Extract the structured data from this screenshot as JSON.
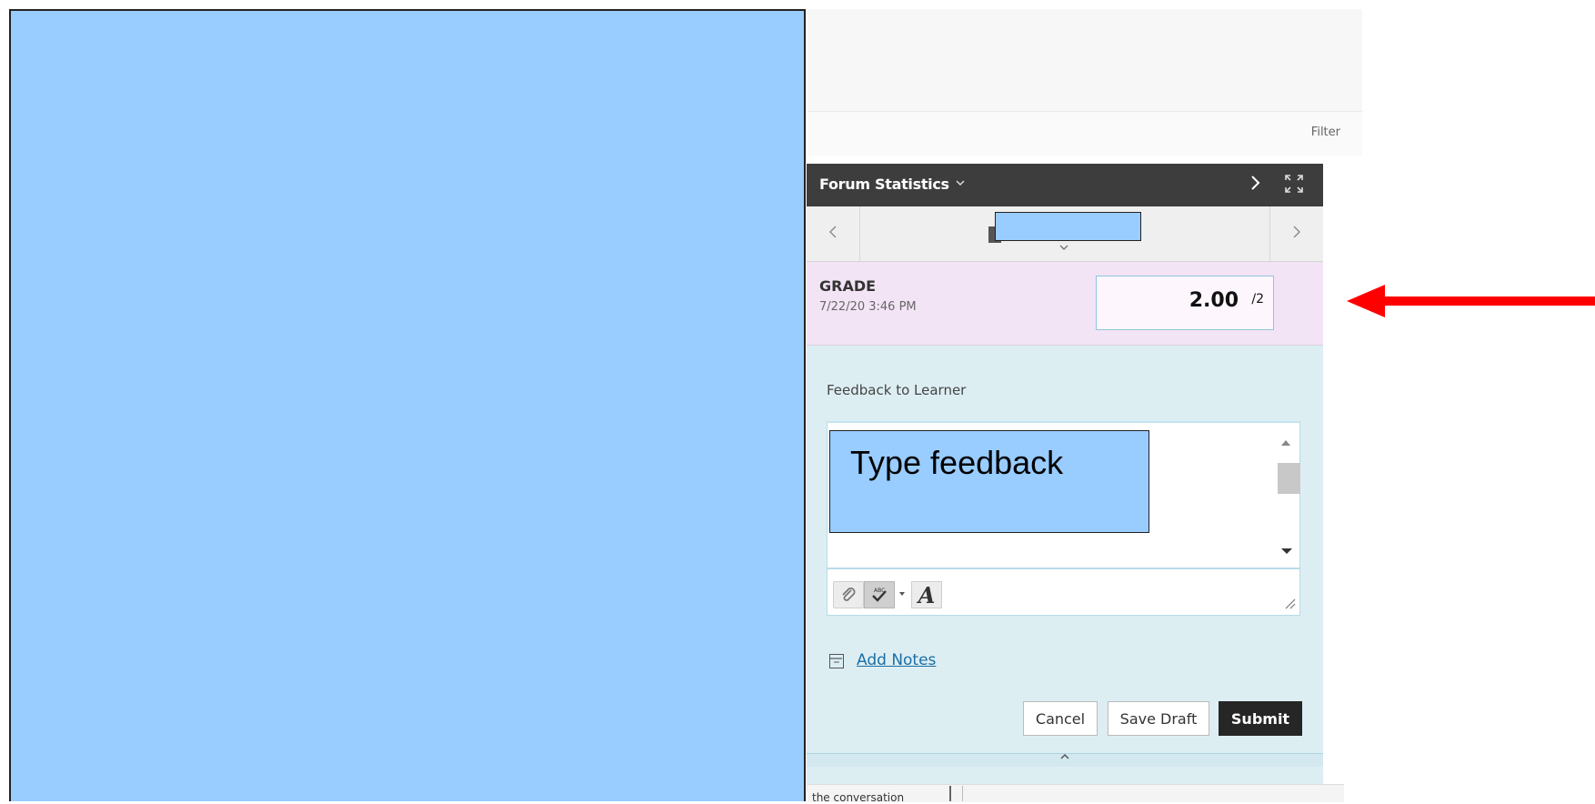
{
  "filter": {
    "label": "Filter"
  },
  "panel": {
    "header": {
      "title": "Forum Statistics",
      "title_chevron": "chevron-down-icon",
      "next_icon": "chevron-right-icon",
      "expand_icon": "expand-icon"
    },
    "nav": {
      "prev_icon": "chevron-left-icon",
      "next_icon": "chevron-right-icon",
      "caret_icon": "chevron-down-icon"
    },
    "grade": {
      "label": "GRADE",
      "date": "7/22/20 3:46 PM",
      "value": "2.00",
      "max": "/2"
    },
    "feedback": {
      "label": "Feedback to Learner",
      "overlay_text": "Type feedback"
    },
    "toolbar": {
      "attach_icon": "paperclip-icon",
      "spell_icon": "spellcheck-icon",
      "font_label": "A"
    },
    "notes": {
      "link_label": "Add Notes"
    },
    "buttons": {
      "cancel": "Cancel",
      "save_draft": "Save Draft",
      "submit": "Submit"
    }
  },
  "bottom": {
    "text": "the conversation"
  },
  "colors": {
    "redaction": "#99ccff",
    "header": "#3d3d3d",
    "grade_row": "#f3e4f5",
    "panel_bg": "#ddeef3",
    "arrow": "#ff0000",
    "link": "#1a6fa6"
  }
}
